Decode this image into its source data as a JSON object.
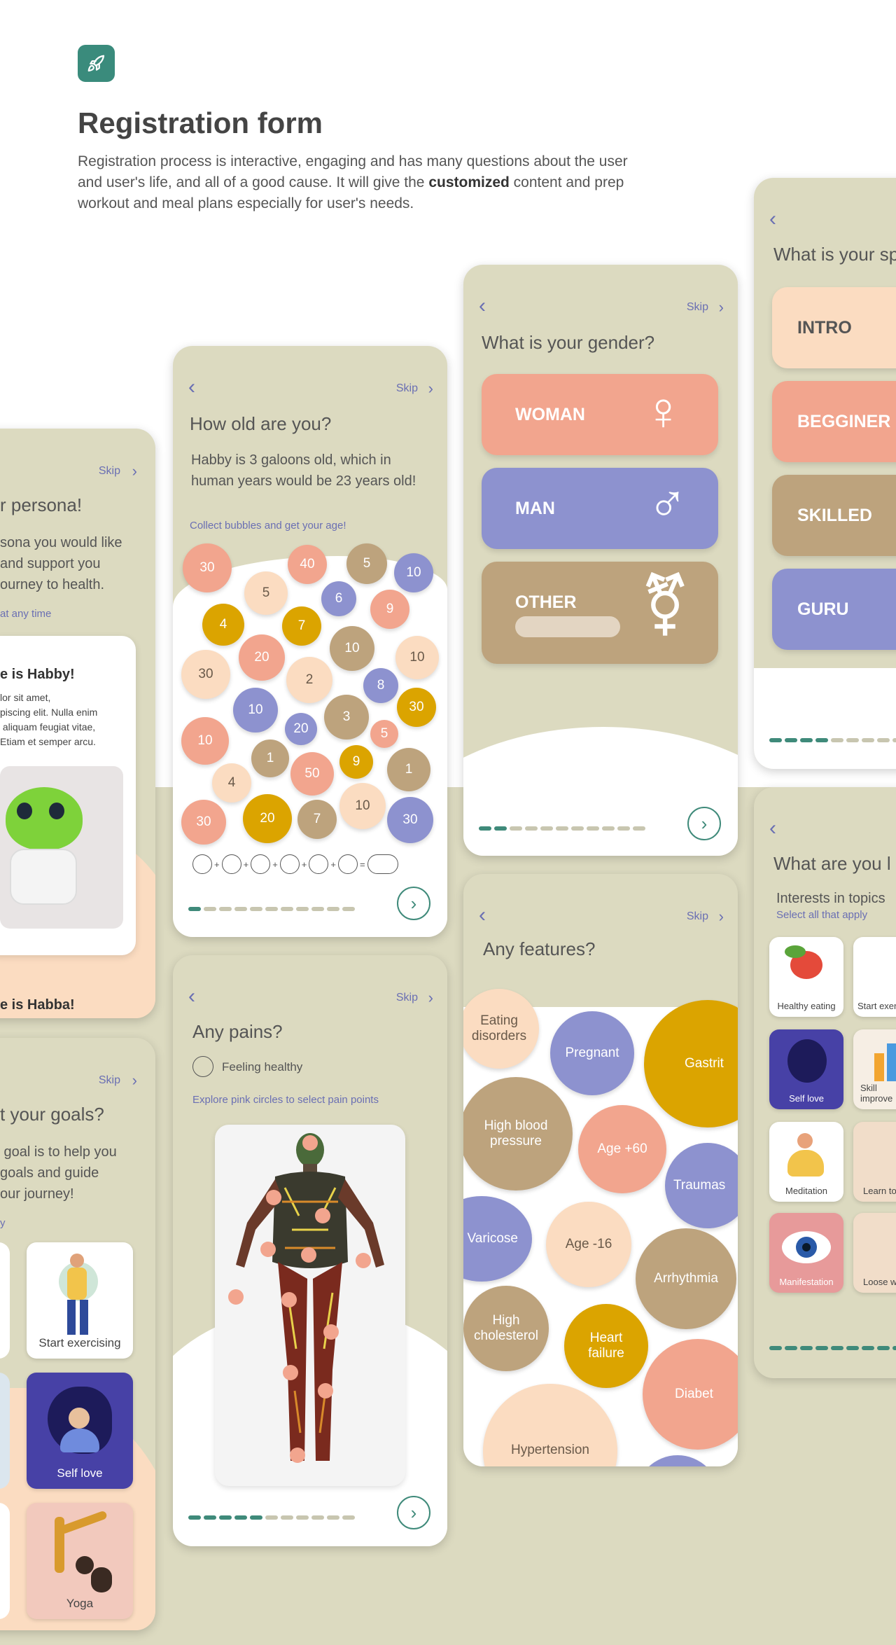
{
  "header": {
    "title": "Registration form",
    "desc_before": "Registration process is interactive, engaging and has many questions about the user and user's life, and all of a good cause. It will give the ",
    "desc_bold": "customized",
    "desc_after": " content and prep workout and meal plans especially for user's needs."
  },
  "common": {
    "skip": "Skip",
    "back": "‹",
    "next": "›"
  },
  "persona": {
    "question": "r persona!",
    "text": "sona you would like\nand support you\nourney to health.",
    "note": "at any time",
    "card_title": "e is Habby!",
    "card_text": "lor sit amet,\npiscing elit. Nulla enim\n aliquam feugiat vitae,\nEtiam et semper arcu.",
    "footer": "e is Habba!"
  },
  "goals": {
    "question": "t your goals?",
    "text": " goal is to help you\ngoals and guide\nour journey!",
    "note": "y",
    "tiles": [
      "Start exercising",
      "Self love",
      "Yoga"
    ]
  },
  "age": {
    "question": "How old are you?",
    "text": "Habby is 3 galoons old, which in human years would be 23 years old!",
    "hint": "Collect bubbles and get your age!",
    "bubbles": [
      "30",
      "40",
      "5",
      "10",
      "5",
      "6",
      "9",
      "4",
      "7",
      "10",
      "30",
      "20",
      "2",
      "8",
      "10",
      "30",
      "10",
      "3",
      "20",
      "5",
      "10",
      "1",
      "9",
      "1",
      "4",
      "50",
      "10",
      "30",
      "20",
      "7",
      "30"
    ],
    "equation_ops": [
      "+",
      "+",
      "+",
      "+",
      "+",
      "="
    ]
  },
  "pains": {
    "question": "Any pains?",
    "option": "Feeling healthy",
    "hint": "Explore pink circles to select pain points"
  },
  "gender": {
    "question": "What is your gender?",
    "options": [
      {
        "label": "WOMAN",
        "symbol": "♀"
      },
      {
        "label": "MAN",
        "symbol": "♂"
      },
      {
        "label": "OTHER",
        "symbol": "⚧"
      }
    ]
  },
  "features": {
    "question": "Any features?",
    "bubbles": [
      "Eating disorders",
      "Pregnant",
      "Gastrit",
      "High blood pressure",
      "Age +60",
      "Traumas",
      "Varicose",
      "Age -16",
      "Arrhythmia",
      "High cholesterol",
      "Heart failure",
      "Diabet",
      "Hypertension"
    ]
  },
  "level": {
    "question": "What is your sp",
    "options": [
      "INTRO",
      "BEGGINER",
      "SKILLED",
      "GURU"
    ]
  },
  "interests": {
    "question": "What are you l",
    "sub": "Interests in topics",
    "note": "Select all that apply",
    "tiles": [
      "Healthy eating",
      "Start exer",
      "Self love",
      "Skill improve",
      "Meditation",
      "Learn to",
      "Manifestation",
      "Loose w"
    ]
  },
  "colors": {
    "accent": "#3f8a7a",
    "link": "#6a6fb3",
    "card": "#dcdac0"
  }
}
